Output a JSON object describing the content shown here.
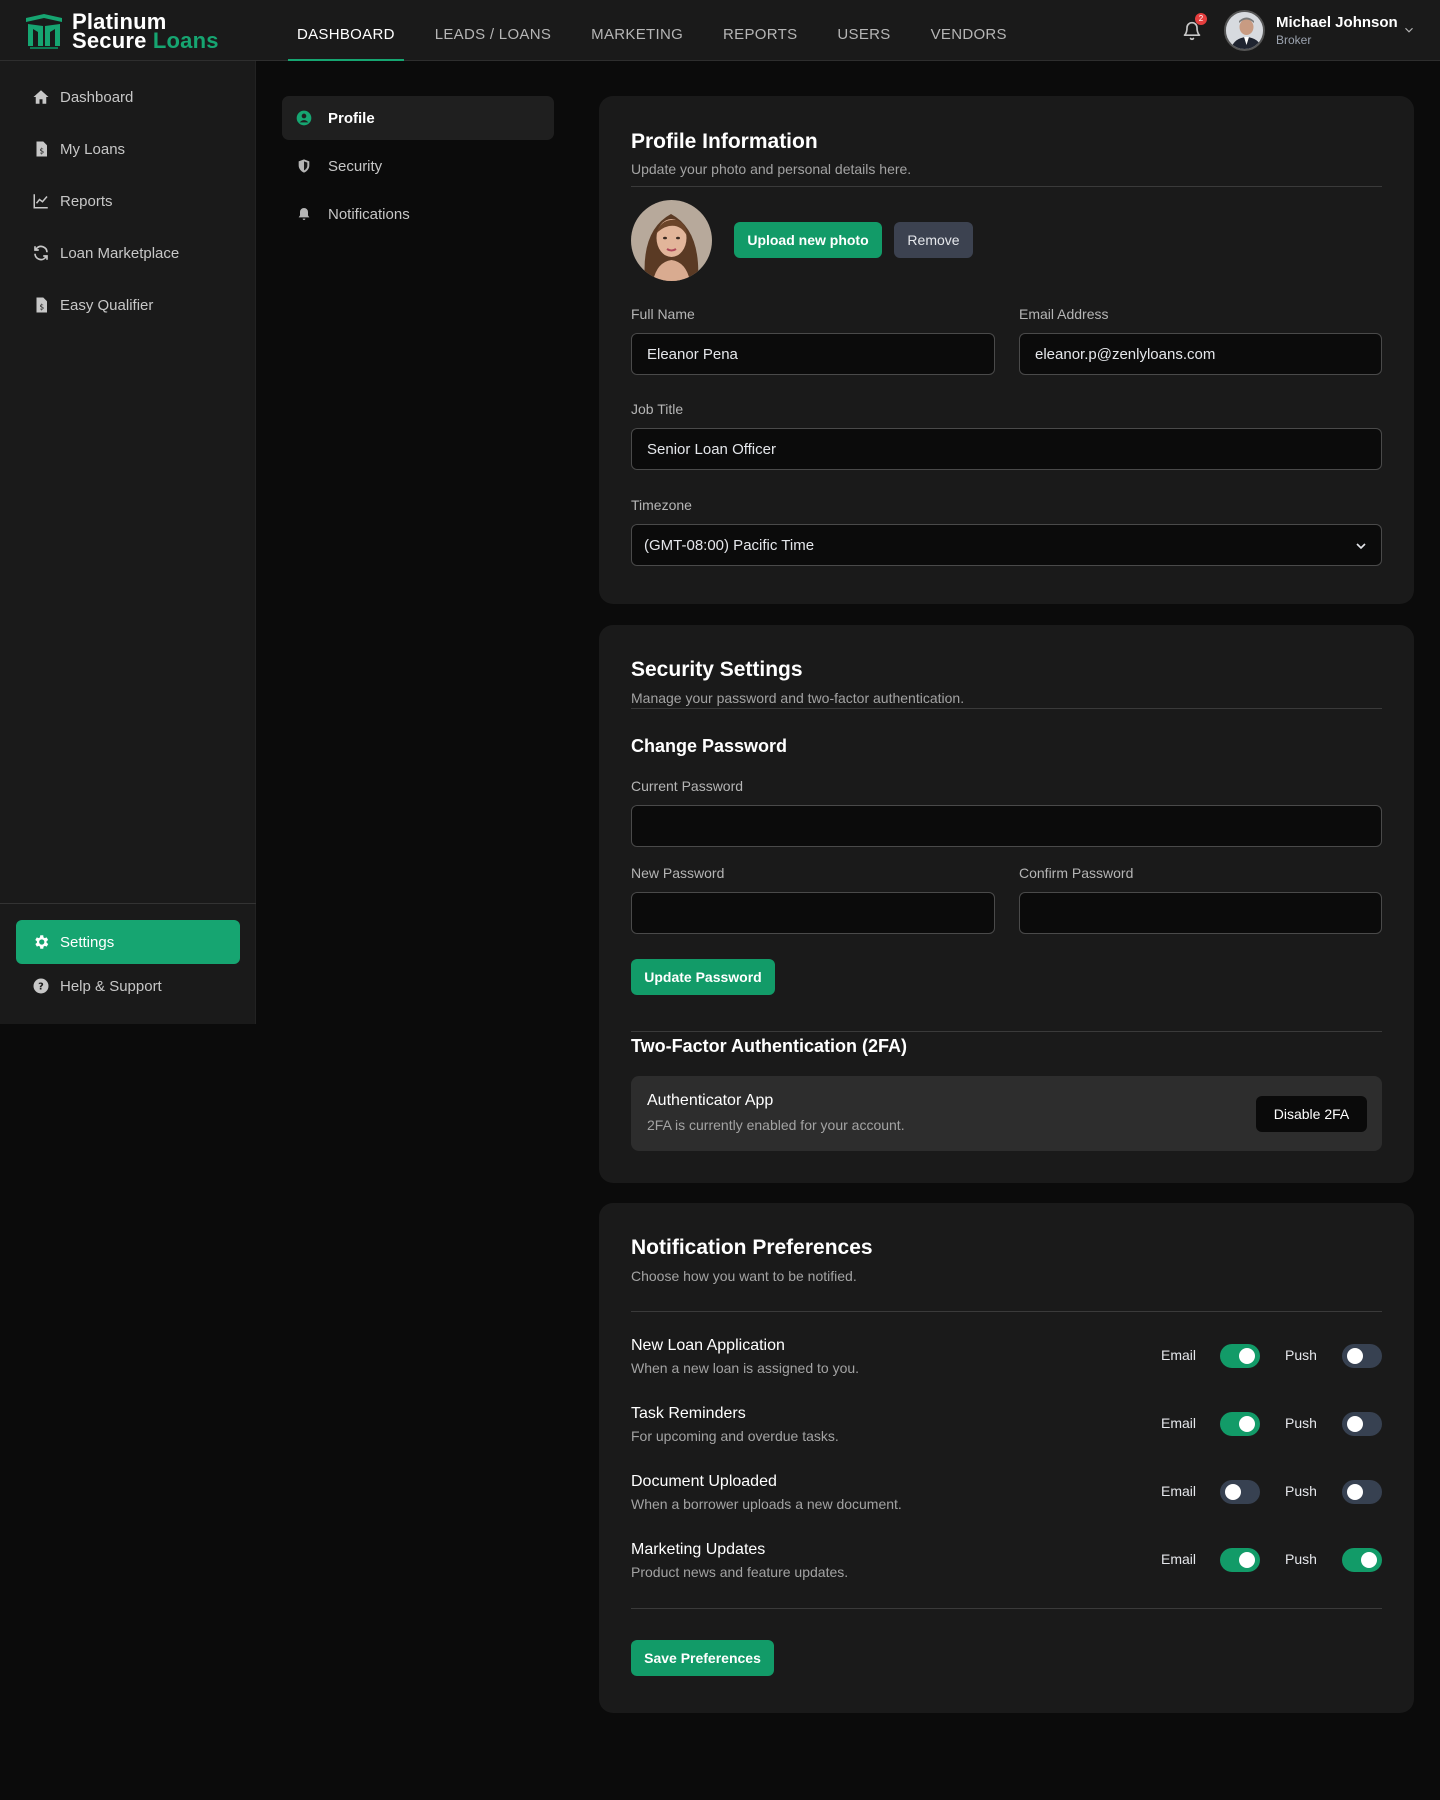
{
  "brand": {
    "line1": "Platinum",
    "line2a": "Secure",
    "line2b": "Loans",
    "accent": "#16a571"
  },
  "topnav": [
    {
      "label": "DASHBOARD",
      "active": true
    },
    {
      "label": "LEADS / LOANS",
      "active": false
    },
    {
      "label": "MARKETING",
      "active": false
    },
    {
      "label": "REPORTS",
      "active": false
    },
    {
      "label": "USERS",
      "active": false
    },
    {
      "label": "VENDORS",
      "active": false
    }
  ],
  "notifications": {
    "count": "2",
    "icon": "bell-icon"
  },
  "user": {
    "name": "Michael Johnson",
    "role": "Broker"
  },
  "sidebar": {
    "items": [
      {
        "label": "Dashboard",
        "icon": "home-icon"
      },
      {
        "label": "My Loans",
        "icon": "document-dollar-icon"
      },
      {
        "label": "Reports",
        "icon": "line-chart-icon"
      },
      {
        "label": "Loan Marketplace",
        "icon": "refresh-icon"
      },
      {
        "label": "Easy Qualifier",
        "icon": "document-dollar-icon"
      }
    ],
    "settings": "Settings",
    "help": "Help & Support"
  },
  "settings_nav": [
    {
      "label": "Profile",
      "icon": "user-circle-icon",
      "active": true
    },
    {
      "label": "Security",
      "icon": "shield-icon",
      "active": false
    },
    {
      "label": "Notifications",
      "icon": "bell-icon",
      "active": false
    }
  ],
  "profile": {
    "title": "Profile Information",
    "subtitle": "Update your photo and personal details here.",
    "upload_label": "Upload new photo",
    "remove_label": "Remove",
    "full_name_label": "Full Name",
    "full_name": "Eleanor Pena",
    "email_label": "Email Address",
    "email": "eleanor.p@zenlyloans.com",
    "job_title_label": "Job Title",
    "job_title": "Senior Loan Officer",
    "timezone_label": "Timezone",
    "timezone": "(GMT-08:00) Pacific Time"
  },
  "security": {
    "title": "Security Settings",
    "subtitle": "Manage your password and two-factor authentication.",
    "change_password": "Change Password",
    "current_label": "Current Password",
    "new_label": "New Password",
    "confirm_label": "Confirm Password",
    "current_value": "",
    "new_value": "",
    "confirm_value": "",
    "update_label": "Update Password",
    "twofa_heading": "Two-Factor Authentication (2FA)",
    "twofa_app": "Authenticator App",
    "twofa_status": "2FA is currently enabled for your account.",
    "disable_label": "Disable 2FA"
  },
  "notif_prefs": {
    "title": "Notification Preferences",
    "subtitle": "Choose how you want to be notified.",
    "email_label": "Email",
    "push_label": "Push",
    "rows": [
      {
        "title": "New Loan Application",
        "desc": "When a new loan is assigned to you.",
        "email": true,
        "push": false
      },
      {
        "title": "Task Reminders",
        "desc": "For upcoming and overdue tasks.",
        "email": true,
        "push": false
      },
      {
        "title": "Document Uploaded",
        "desc": "When a borrower uploads a new document.",
        "email": false,
        "push": false
      },
      {
        "title": "Marketing Updates",
        "desc": "Product news and feature updates.",
        "email": true,
        "push": true
      }
    ],
    "save_label": "Save Preferences"
  }
}
